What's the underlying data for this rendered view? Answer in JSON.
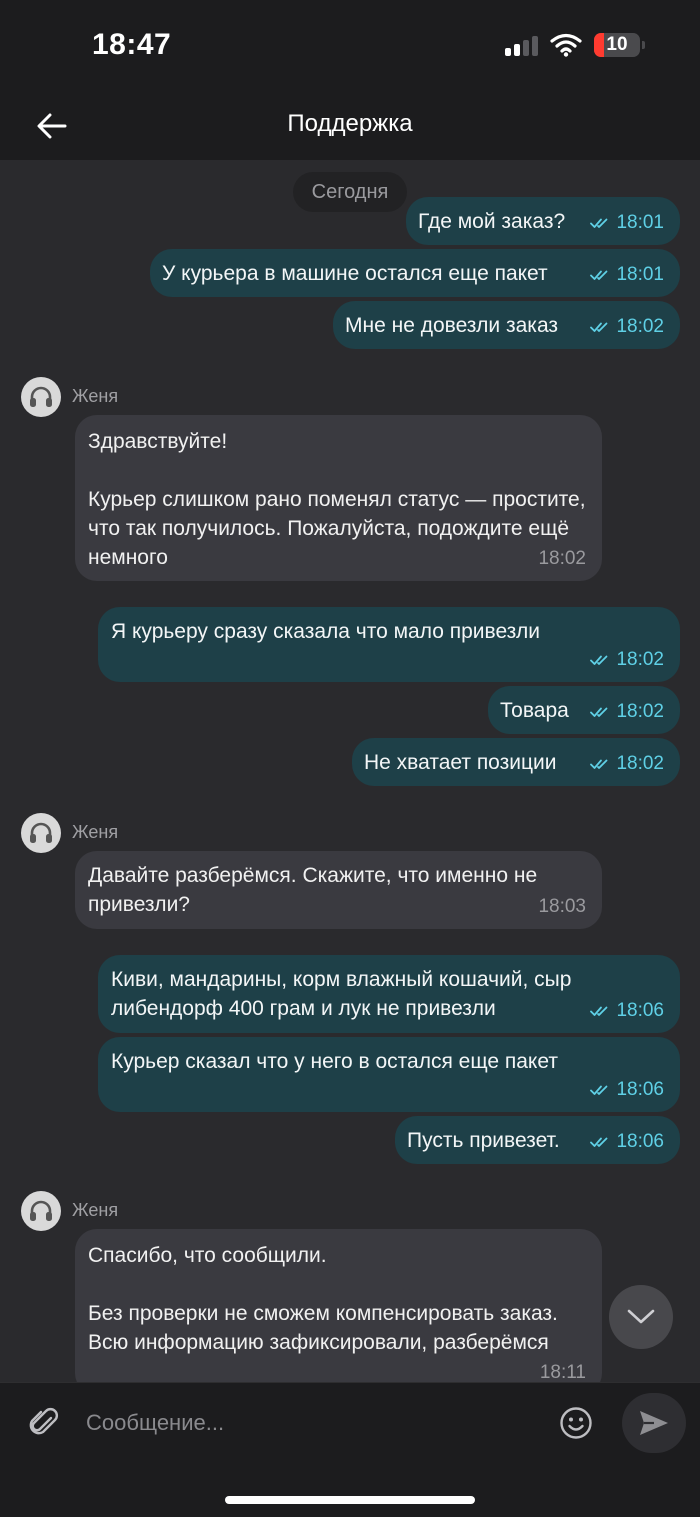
{
  "status_bar": {
    "time": "18:47",
    "battery": "10"
  },
  "header": {
    "title": "Поддержка"
  },
  "chat": {
    "date_label": "Сегодня",
    "messages": [
      {
        "dir": "out",
        "text": "Где мой заказ?",
        "time": "18:01"
      },
      {
        "dir": "out",
        "text": "У курьера в машине остался еще пакет",
        "time": "18:01"
      },
      {
        "dir": "out",
        "text": "Мне не довезли заказ",
        "time": "18:02"
      },
      {
        "dir": "in",
        "sender": "Женя",
        "text": "Здравствуйте!\n\nКурьер слишком рано поменял статус — простите, что так получилось. Пожалуйста, подождите ещё немного",
        "time": "18:02"
      },
      {
        "dir": "out",
        "text": "Я курьеру сразу сказала что мало привезли",
        "time": "18:02"
      },
      {
        "dir": "out",
        "text": "Товара",
        "time": "18:02"
      },
      {
        "dir": "out",
        "text": "Не хватает позиции",
        "time": "18:02"
      },
      {
        "dir": "in",
        "sender": "Женя",
        "text": "Давайте разберёмся. Скажите, что именно не привезли?",
        "time": "18:03"
      },
      {
        "dir": "out",
        "text": "Киви, мандарины, корм влажный кошачий, сыр либендорф 400 грам и лук не привезли",
        "time": "18:06"
      },
      {
        "dir": "out",
        "text": "Курьер сказал что у него в остался еще пакет",
        "time": "18:06"
      },
      {
        "dir": "out",
        "text": "Пусть привезет.",
        "time": "18:06"
      },
      {
        "dir": "in",
        "sender": "Женя",
        "text": "Спасибо, что сообщили.\n\nБез проверки не сможем компенсировать заказ. Всю информацию зафиксировали, разберёмся",
        "time": "18:11"
      }
    ]
  },
  "composer": {
    "placeholder": "Сообщение..."
  },
  "colors": {
    "background": "#2a2a2d",
    "outgoing_bubble": "#1e4048",
    "incoming_bubble": "#3a3a40",
    "time_accent": "#5fd0e6"
  }
}
